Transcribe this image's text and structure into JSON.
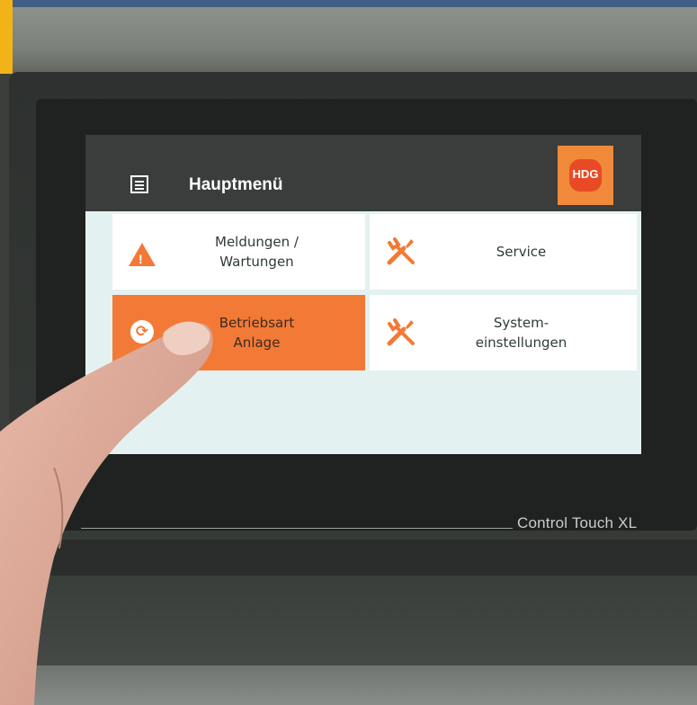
{
  "screen": {
    "title": "Hauptmenü",
    "logo_text": "HDG",
    "tiles": [
      {
        "label": "Meldungen /\nWartungen",
        "icon": "warning-icon",
        "active": false
      },
      {
        "label": "Service",
        "icon": "tools-icon",
        "active": false
      },
      {
        "label": "Betriebsart\nAnlage",
        "icon": "refresh-icon",
        "active": true
      },
      {
        "label": "System-\neinstellungen",
        "icon": "tools-icon",
        "active": false
      }
    ]
  },
  "device": {
    "brand": "Control Touch XL"
  },
  "colors": {
    "accent": "#f27a36",
    "screen_bg": "#e3f2f1",
    "header_bg": "#3a3d3b",
    "logo_bg": "#f08a3a"
  }
}
